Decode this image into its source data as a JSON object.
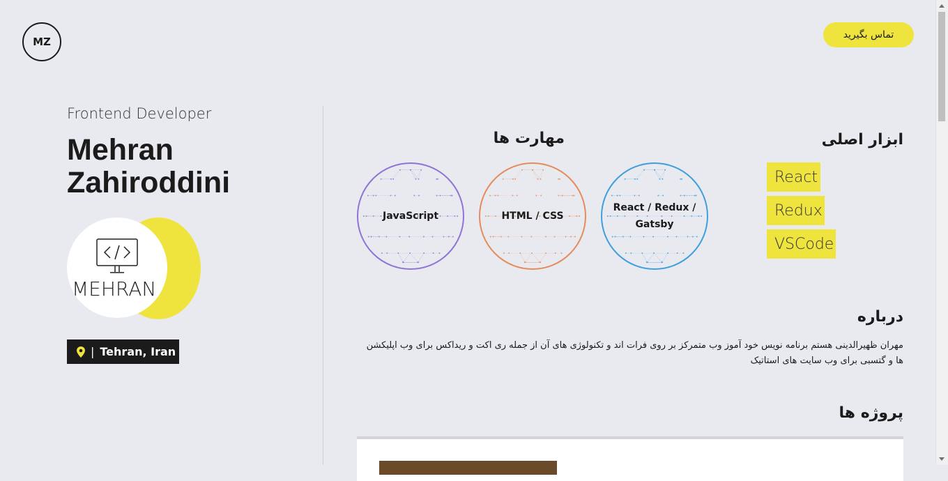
{
  "header": {
    "logo": "MZ",
    "contact_label": "تماس بگیرید"
  },
  "profile": {
    "role": "Frontend Developer",
    "name_first": "Mehran",
    "name_last": "Zahiroddini",
    "avatar_text": "MEHRAN",
    "location": "Tehran, Iran",
    "location_icon": "map-pin-icon"
  },
  "skills": {
    "title": "مهارت ها",
    "items": [
      {
        "label": "JavaScript",
        "color": "#8f74d6"
      },
      {
        "label": "HTML / CSS",
        "color": "#e58b5c"
      },
      {
        "label": "React / Redux / Gatsby",
        "color": "#3e9fdf"
      }
    ]
  },
  "tools": {
    "title": "ابزار اصلی",
    "items": [
      "React",
      "Redux",
      "VSCode"
    ]
  },
  "about": {
    "title": "درباره",
    "text": "مهران ظهیرالدینی هستم برنامه نویس خود آموز وب متمرکز بر روی فرات اند و تکنولوژی های آن از جمله ری اکت و ریداکس برای وب اپلیکشن ها و گتسبی برای وب سایت های استاتیک"
  },
  "projects": {
    "title": "پروژه ها"
  },
  "colors": {
    "background": "#e9eaef",
    "accent": "#efe43d",
    "dark": "#1b1b1b"
  }
}
